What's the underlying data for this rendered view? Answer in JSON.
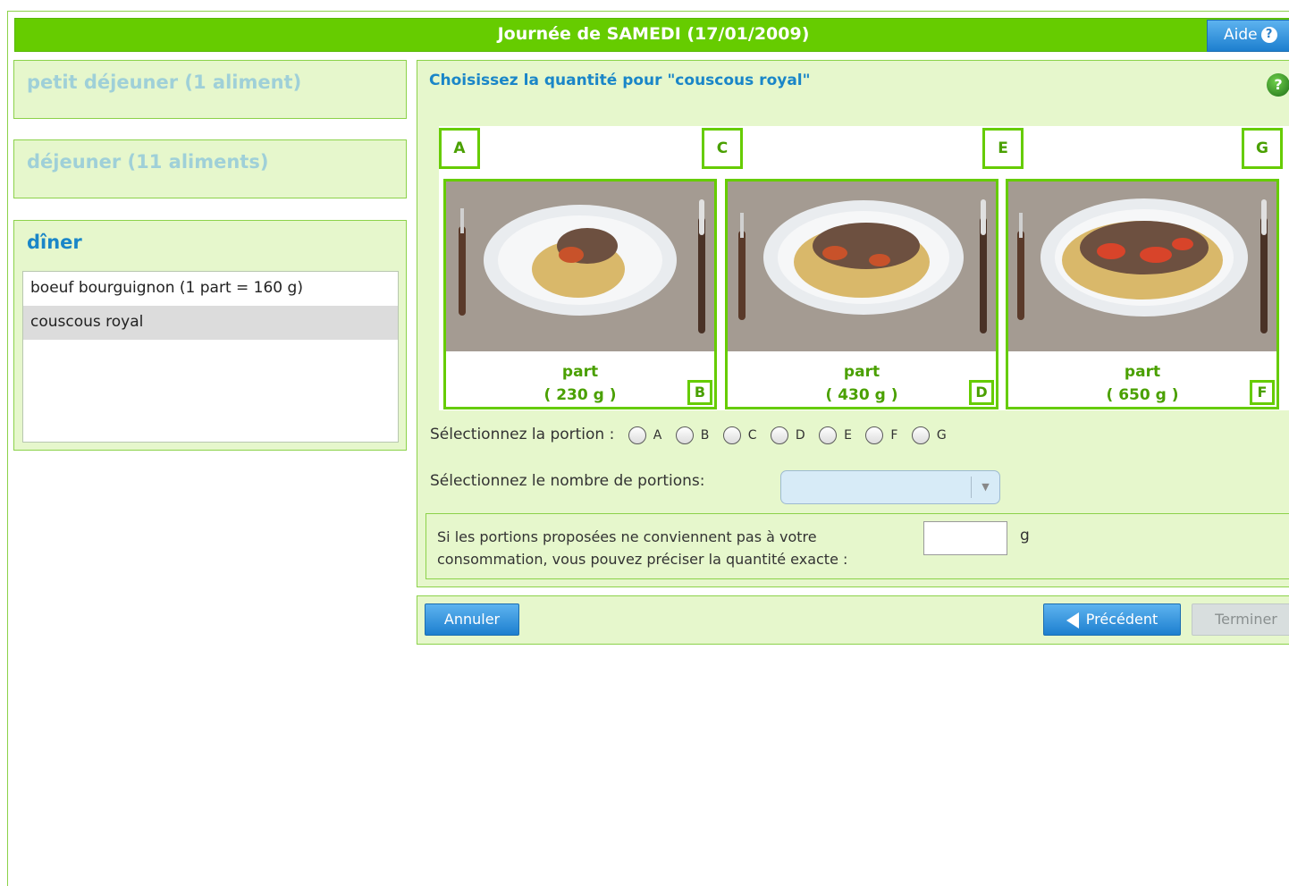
{
  "header": {
    "title": "Journée de SAMEDI (17/01/2009)",
    "help_label": "Aide"
  },
  "meals": {
    "breakfast": "petit déjeuner (1 aliment)",
    "lunch": "déjeuner (11 aliments)",
    "dinner": "dîner"
  },
  "dinner_items": [
    "boeuf bourguignon (1 part = 160 g)",
    "couscous royal"
  ],
  "question": {
    "title": "Choisissez la quantité pour \"couscous royal\""
  },
  "portions": {
    "letters_top": [
      "A",
      "C",
      "E",
      "G"
    ],
    "letters_bottom": [
      "B",
      "D",
      "F"
    ],
    "photos": [
      {
        "label": "part",
        "weight": "( 230 g )"
      },
      {
        "label": "part",
        "weight": "( 430 g )"
      },
      {
        "label": "part",
        "weight": "( 650 g )"
      }
    ]
  },
  "selection": {
    "portion_label": "Sélectionnez la portion :",
    "options": [
      "A",
      "B",
      "C",
      "D",
      "E",
      "F",
      "G"
    ],
    "count_label": "Sélectionnez le nombre de portions:",
    "count_value": ""
  },
  "exact": {
    "text": "Si les portions proposées ne conviennent pas à votre consommation, vous pouvez préciser la quantité exacte :",
    "value": "",
    "unit": "g"
  },
  "buttons": {
    "cancel": "Annuler",
    "previous": "Précédent",
    "finish": "Terminer"
  },
  "colors": {
    "accent_green": "#66cc00",
    "panel_bg": "#e6f7cc",
    "button_blue": "#1d7fcf",
    "title_blue": "#1a86c8"
  }
}
